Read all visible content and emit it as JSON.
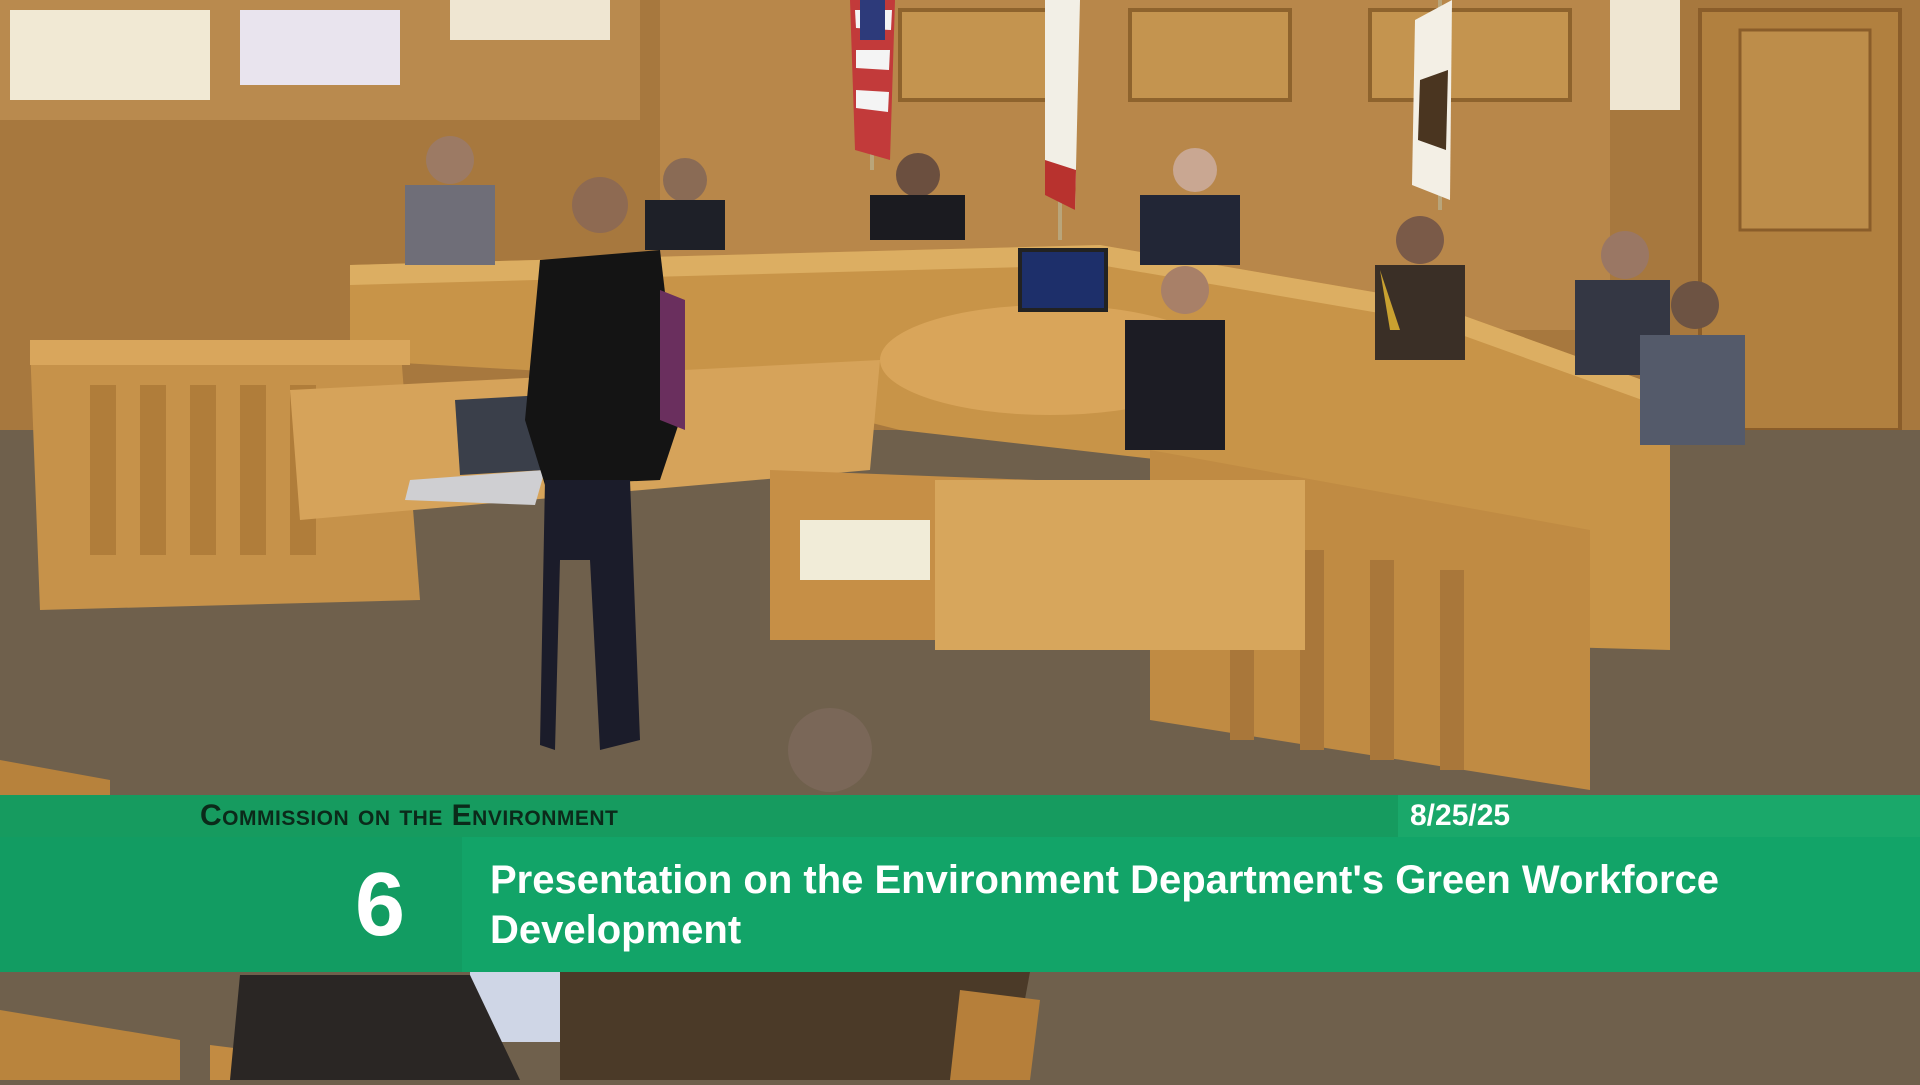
{
  "caption": {
    "commission": "Commission on the Environment",
    "date": "8/25/25",
    "item_number": "6",
    "item_title": "Presentation on the Environment Department's Green Workforce Development"
  },
  "colors": {
    "band_green": "#12a468",
    "band_dark_green": "#169b5f",
    "title_text": "#0b2a1a",
    "wood": "#c89448",
    "carpet": "#6f604c"
  },
  "scene": {
    "flags": [
      "us-flag",
      "california-flag",
      "san-francisco-flag"
    ]
  }
}
